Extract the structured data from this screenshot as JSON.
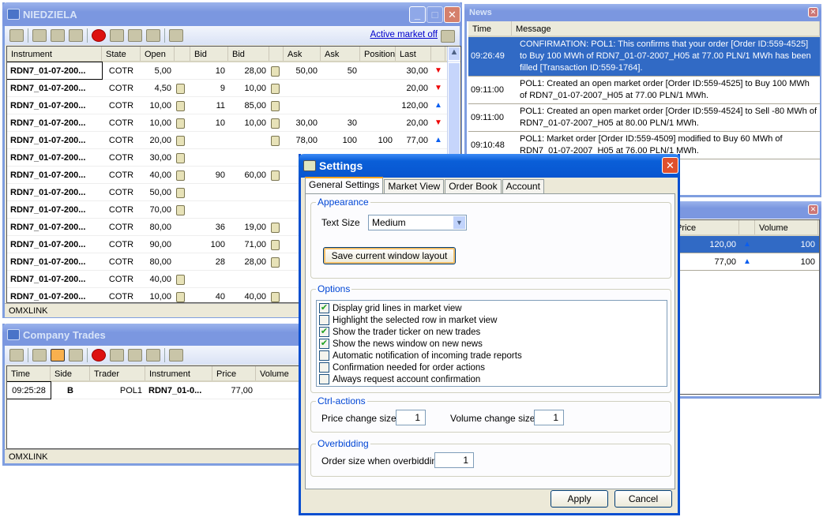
{
  "market": {
    "title": "NIEDZIELA",
    "active_market": "Active market off",
    "status": "OMXLINK",
    "columns": [
      "Instrument",
      "State",
      "Open",
      "",
      "Bid",
      "Bid",
      "",
      "Ask",
      "Ask",
      "Position",
      "Last",
      ""
    ],
    "rows": [
      [
        "RDN7_01-07-200...",
        "COTR",
        "5,00",
        false,
        "10",
        "28,00",
        "note",
        "50,00",
        "50",
        "",
        "30,00",
        "down"
      ],
      [
        "RDN7_01-07-200...",
        "COTR",
        "4,50",
        true,
        "9",
        "10,00",
        "note",
        "",
        "",
        "",
        "20,00",
        "down"
      ],
      [
        "RDN7_01-07-200...",
        "COTR",
        "10,00",
        true,
        "11",
        "85,00",
        "note",
        "",
        "",
        "",
        "120,00",
        "up"
      ],
      [
        "RDN7_01-07-200...",
        "COTR",
        "10,00",
        true,
        "10",
        "10,00",
        "note",
        "30,00",
        "30",
        "",
        "20,00",
        "down"
      ],
      [
        "RDN7_01-07-200...",
        "COTR",
        "20,00",
        true,
        "",
        "",
        "edit",
        "78,00",
        "100",
        "100",
        "77,00",
        "up"
      ],
      [
        "RDN7_01-07-200...",
        "COTR",
        "30,00",
        true,
        "",
        "",
        "",
        "",
        "",
        "",
        "",
        ""
      ],
      [
        "RDN7_01-07-200...",
        "COTR",
        "40,00",
        true,
        "90",
        "60,00",
        "note",
        "",
        "",
        "",
        "",
        ""
      ],
      [
        "RDN7_01-07-200...",
        "COTR",
        "50,00",
        true,
        "",
        "",
        "",
        "",
        "",
        "",
        "",
        ""
      ],
      [
        "RDN7_01-07-200...",
        "COTR",
        "70,00",
        true,
        "",
        "",
        "",
        "",
        "",
        "",
        "",
        ""
      ],
      [
        "RDN7_01-07-200...",
        "COTR",
        "80,00",
        false,
        "36",
        "19,00",
        "note",
        "",
        "",
        "",
        "",
        ""
      ],
      [
        "RDN7_01-07-200...",
        "COTR",
        "90,00",
        false,
        "100",
        "71,00",
        "note",
        "",
        "",
        "",
        "",
        ""
      ],
      [
        "RDN7_01-07-200...",
        "COTR",
        "80,00",
        false,
        "28",
        "28,00",
        "note",
        "",
        "",
        "",
        "",
        ""
      ],
      [
        "RDN7_01-07-200...",
        "COTR",
        "40,00",
        true,
        "",
        "",
        "",
        "",
        "",
        "",
        "",
        ""
      ],
      [
        "RDN7_01-07-200...",
        "COTR",
        "10,00",
        true,
        "40",
        "40,00",
        "note",
        "",
        "",
        "",
        "",
        ""
      ]
    ]
  },
  "trades": {
    "title": "Company Trades",
    "status": "OMXLINK",
    "columns": [
      "Time",
      "Side",
      "Trader",
      "Instrument",
      "Price",
      "Volume"
    ],
    "rows": [
      [
        "09:25:28",
        "B",
        "POL1",
        "RDN7_01-0...",
        "77,00",
        ""
      ]
    ]
  },
  "news": {
    "title": "News",
    "columns": [
      "Time",
      "Message"
    ],
    "rows": [
      [
        "09:26:49",
        "CONFIRMATION: POL1: This confirms that your order [Order ID:559-4525] to Buy 100 MWh of RDN7_01-07-2007_H05 at 77.00 PLN/1 MWh has been filled [Transaction ID:559-1764]."
      ],
      [
        "09:11:00",
        "POL1: Created an open market order [Order ID:559-4525] to Buy 100 MWh of RDN7_01-07-2007_H05 at 77.00 PLN/1 MWh."
      ],
      [
        "09:11:00",
        "POL1: Created an open market order [Order ID:559-4524] to Sell -80 MWh of RDN7_01-07-2007_H05 at 80.00 PLN/1 MWh."
      ],
      [
        "09:10:48",
        "POL1: Market order [Order ID:559-4509] modified to Buy 60 MWh of RDN7_01-07-2007_H05 at 76.00 PLN/1 MWh."
      ]
    ]
  },
  "ticker": {
    "columns": [
      "Price",
      "",
      "Volume"
    ],
    "rows": [
      [
        "120,00",
        "up",
        "100"
      ],
      [
        "77,00",
        "up",
        "100"
      ]
    ]
  },
  "settings": {
    "title": "Settings",
    "tabs": [
      "General Settings",
      "Market View",
      "Order Book",
      "Account"
    ],
    "appearance": "Appearance",
    "text_size_label": "Text Size",
    "text_size": "Medium",
    "save_layout": "Save current window layout",
    "options_label": "Options",
    "options": [
      {
        "label": "Display grid lines in market view",
        "checked": true
      },
      {
        "label": "Highlight the selected row in market view",
        "checked": false
      },
      {
        "label": "Show the trader ticker on new trades",
        "checked": true
      },
      {
        "label": "Show the news window on new news",
        "checked": true
      },
      {
        "label": "Automatic notification of incoming trade reports",
        "checked": false
      },
      {
        "label": "Confirmation needed for order actions",
        "checked": false
      },
      {
        "label": "Always request account confirmation",
        "checked": false
      }
    ],
    "ctrl_label": "Ctrl-actions",
    "price_change_label": "Price change size",
    "price_change": "1",
    "volume_change_label": "Volume change size",
    "volume_change": "1",
    "overbid_label": "Overbidding",
    "overbid_size_label": "Order size when overbidding",
    "overbid_size": "1",
    "apply": "Apply",
    "cancel": "Cancel"
  },
  "colors": {
    "selection": "#316ac5",
    "up_arrow": "#0a5ef0",
    "down_arrow": "#e00000",
    "active_title": "#0a5fd8"
  }
}
